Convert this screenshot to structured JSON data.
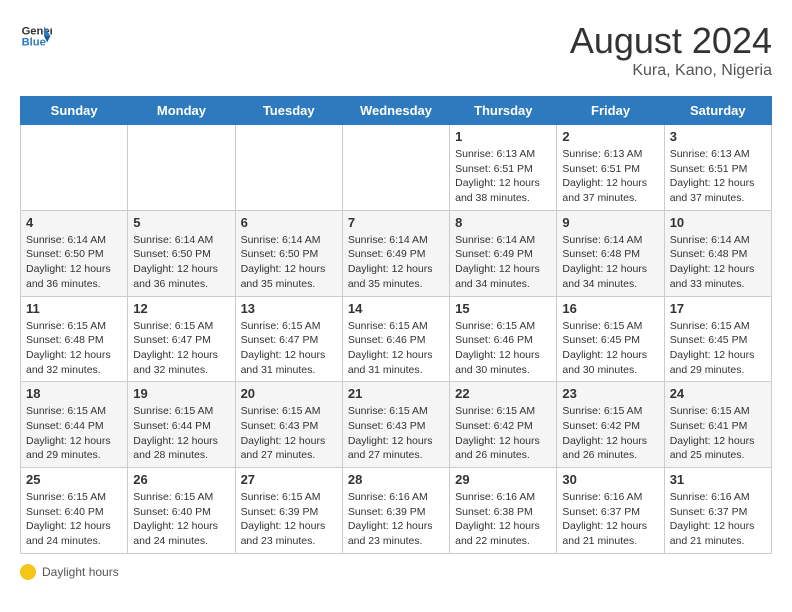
{
  "logo": {
    "line1": "General",
    "line2": "Blue"
  },
  "title": {
    "month_year": "August 2024",
    "location": "Kura, Kano, Nigeria"
  },
  "days_of_week": [
    "Sunday",
    "Monday",
    "Tuesday",
    "Wednesday",
    "Thursday",
    "Friday",
    "Saturday"
  ],
  "weeks": [
    [
      {
        "day": "",
        "info": ""
      },
      {
        "day": "",
        "info": ""
      },
      {
        "day": "",
        "info": ""
      },
      {
        "day": "",
        "info": ""
      },
      {
        "day": "1",
        "info": "Sunrise: 6:13 AM\nSunset: 6:51 PM\nDaylight: 12 hours\nand 38 minutes."
      },
      {
        "day": "2",
        "info": "Sunrise: 6:13 AM\nSunset: 6:51 PM\nDaylight: 12 hours\nand 37 minutes."
      },
      {
        "day": "3",
        "info": "Sunrise: 6:13 AM\nSunset: 6:51 PM\nDaylight: 12 hours\nand 37 minutes."
      }
    ],
    [
      {
        "day": "4",
        "info": "Sunrise: 6:14 AM\nSunset: 6:50 PM\nDaylight: 12 hours\nand 36 minutes."
      },
      {
        "day": "5",
        "info": "Sunrise: 6:14 AM\nSunset: 6:50 PM\nDaylight: 12 hours\nand 36 minutes."
      },
      {
        "day": "6",
        "info": "Sunrise: 6:14 AM\nSunset: 6:50 PM\nDaylight: 12 hours\nand 35 minutes."
      },
      {
        "day": "7",
        "info": "Sunrise: 6:14 AM\nSunset: 6:49 PM\nDaylight: 12 hours\nand 35 minutes."
      },
      {
        "day": "8",
        "info": "Sunrise: 6:14 AM\nSunset: 6:49 PM\nDaylight: 12 hours\nand 34 minutes."
      },
      {
        "day": "9",
        "info": "Sunrise: 6:14 AM\nSunset: 6:48 PM\nDaylight: 12 hours\nand 34 minutes."
      },
      {
        "day": "10",
        "info": "Sunrise: 6:14 AM\nSunset: 6:48 PM\nDaylight: 12 hours\nand 33 minutes."
      }
    ],
    [
      {
        "day": "11",
        "info": "Sunrise: 6:15 AM\nSunset: 6:48 PM\nDaylight: 12 hours\nand 32 minutes."
      },
      {
        "day": "12",
        "info": "Sunrise: 6:15 AM\nSunset: 6:47 PM\nDaylight: 12 hours\nand 32 minutes."
      },
      {
        "day": "13",
        "info": "Sunrise: 6:15 AM\nSunset: 6:47 PM\nDaylight: 12 hours\nand 31 minutes."
      },
      {
        "day": "14",
        "info": "Sunrise: 6:15 AM\nSunset: 6:46 PM\nDaylight: 12 hours\nand 31 minutes."
      },
      {
        "day": "15",
        "info": "Sunrise: 6:15 AM\nSunset: 6:46 PM\nDaylight: 12 hours\nand 30 minutes."
      },
      {
        "day": "16",
        "info": "Sunrise: 6:15 AM\nSunset: 6:45 PM\nDaylight: 12 hours\nand 30 minutes."
      },
      {
        "day": "17",
        "info": "Sunrise: 6:15 AM\nSunset: 6:45 PM\nDaylight: 12 hours\nand 29 minutes."
      }
    ],
    [
      {
        "day": "18",
        "info": "Sunrise: 6:15 AM\nSunset: 6:44 PM\nDaylight: 12 hours\nand 29 minutes."
      },
      {
        "day": "19",
        "info": "Sunrise: 6:15 AM\nSunset: 6:44 PM\nDaylight: 12 hours\nand 28 minutes."
      },
      {
        "day": "20",
        "info": "Sunrise: 6:15 AM\nSunset: 6:43 PM\nDaylight: 12 hours\nand 27 minutes."
      },
      {
        "day": "21",
        "info": "Sunrise: 6:15 AM\nSunset: 6:43 PM\nDaylight: 12 hours\nand 27 minutes."
      },
      {
        "day": "22",
        "info": "Sunrise: 6:15 AM\nSunset: 6:42 PM\nDaylight: 12 hours\nand 26 minutes."
      },
      {
        "day": "23",
        "info": "Sunrise: 6:15 AM\nSunset: 6:42 PM\nDaylight: 12 hours\nand 26 minutes."
      },
      {
        "day": "24",
        "info": "Sunrise: 6:15 AM\nSunset: 6:41 PM\nDaylight: 12 hours\nand 25 minutes."
      }
    ],
    [
      {
        "day": "25",
        "info": "Sunrise: 6:15 AM\nSunset: 6:40 PM\nDaylight: 12 hours\nand 24 minutes."
      },
      {
        "day": "26",
        "info": "Sunrise: 6:15 AM\nSunset: 6:40 PM\nDaylight: 12 hours\nand 24 minutes."
      },
      {
        "day": "27",
        "info": "Sunrise: 6:15 AM\nSunset: 6:39 PM\nDaylight: 12 hours\nand 23 minutes."
      },
      {
        "day": "28",
        "info": "Sunrise: 6:16 AM\nSunset: 6:39 PM\nDaylight: 12 hours\nand 23 minutes."
      },
      {
        "day": "29",
        "info": "Sunrise: 6:16 AM\nSunset: 6:38 PM\nDaylight: 12 hours\nand 22 minutes."
      },
      {
        "day": "30",
        "info": "Sunrise: 6:16 AM\nSunset: 6:37 PM\nDaylight: 12 hours\nand 21 minutes."
      },
      {
        "day": "31",
        "info": "Sunrise: 6:16 AM\nSunset: 6:37 PM\nDaylight: 12 hours\nand 21 minutes."
      }
    ]
  ],
  "footer": {
    "note": "Daylight hours"
  }
}
